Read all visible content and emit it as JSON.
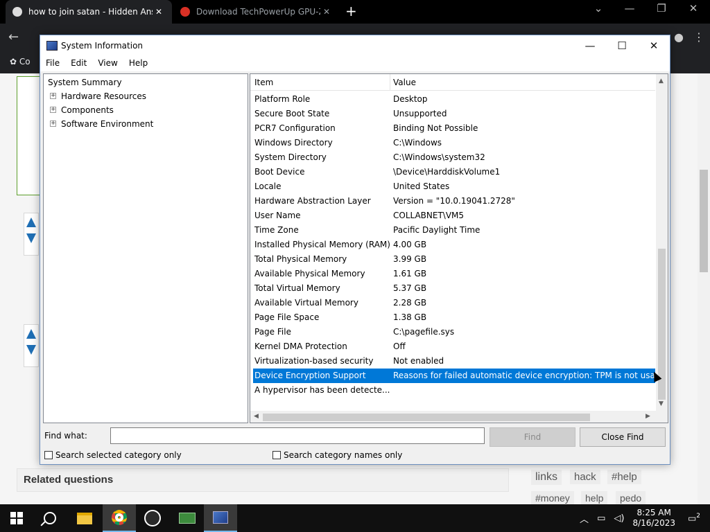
{
  "browser": {
    "tabs": [
      {
        "title": "how to join satan - Hidden Answ",
        "close": "✕"
      },
      {
        "title": "Download TechPowerUp GPU-Z",
        "close": "✕"
      }
    ],
    "new_tab": "+",
    "bookmark_fragment": "Co",
    "related_title": "Related questions",
    "tags": [
      "links",
      "hack",
      "#help",
      "#money",
      "help",
      "pedo"
    ]
  },
  "window": {
    "title": "System Information",
    "menu": [
      "File",
      "Edit",
      "View",
      "Help"
    ],
    "tree": {
      "root": "System Summary",
      "children": [
        "Hardware Resources",
        "Components",
        "Software Environment"
      ]
    },
    "columns": {
      "item": "Item",
      "value": "Value"
    },
    "rows": [
      {
        "item": "Platform Role",
        "value": "Desktop"
      },
      {
        "item": "Secure Boot State",
        "value": "Unsupported"
      },
      {
        "item": "PCR7 Configuration",
        "value": "Binding Not Possible"
      },
      {
        "item": "Windows Directory",
        "value": "C:\\Windows"
      },
      {
        "item": "System Directory",
        "value": "C:\\Windows\\system32"
      },
      {
        "item": "Boot Device",
        "value": "\\Device\\HarddiskVolume1"
      },
      {
        "item": "Locale",
        "value": "United States"
      },
      {
        "item": "Hardware Abstraction Layer",
        "value": "Version = \"10.0.19041.2728\""
      },
      {
        "item": "User Name",
        "value": "COLLABNET\\VM5"
      },
      {
        "item": "Time Zone",
        "value": "Pacific Daylight Time"
      },
      {
        "item": "Installed Physical Memory (RAM)",
        "value": "4.00 GB"
      },
      {
        "item": "Total Physical Memory",
        "value": "3.99 GB"
      },
      {
        "item": "Available Physical Memory",
        "value": "1.61 GB"
      },
      {
        "item": "Total Virtual Memory",
        "value": "5.37 GB"
      },
      {
        "item": "Available Virtual Memory",
        "value": "2.28 GB"
      },
      {
        "item": "Page File Space",
        "value": "1.38 GB"
      },
      {
        "item": "Page File",
        "value": "C:\\pagefile.sys"
      },
      {
        "item": "Kernel DMA Protection",
        "value": "Off"
      },
      {
        "item": "Virtualization-based security",
        "value": "Not enabled"
      },
      {
        "item": "Device Encryption Support",
        "value": "Reasons for failed automatic device encryption: TPM is not usab",
        "selected": true
      },
      {
        "item": "A hypervisor has been detecte...",
        "value": ""
      }
    ],
    "find": {
      "label": "Find what:",
      "value": "",
      "find_button": "Find",
      "close_button": "Close Find",
      "check_selected": "Search selected category only",
      "check_names": "Search category names only"
    }
  },
  "taskbar": {
    "time": "8:25 AM",
    "date": "8/16/2023",
    "notification_count": "2"
  }
}
